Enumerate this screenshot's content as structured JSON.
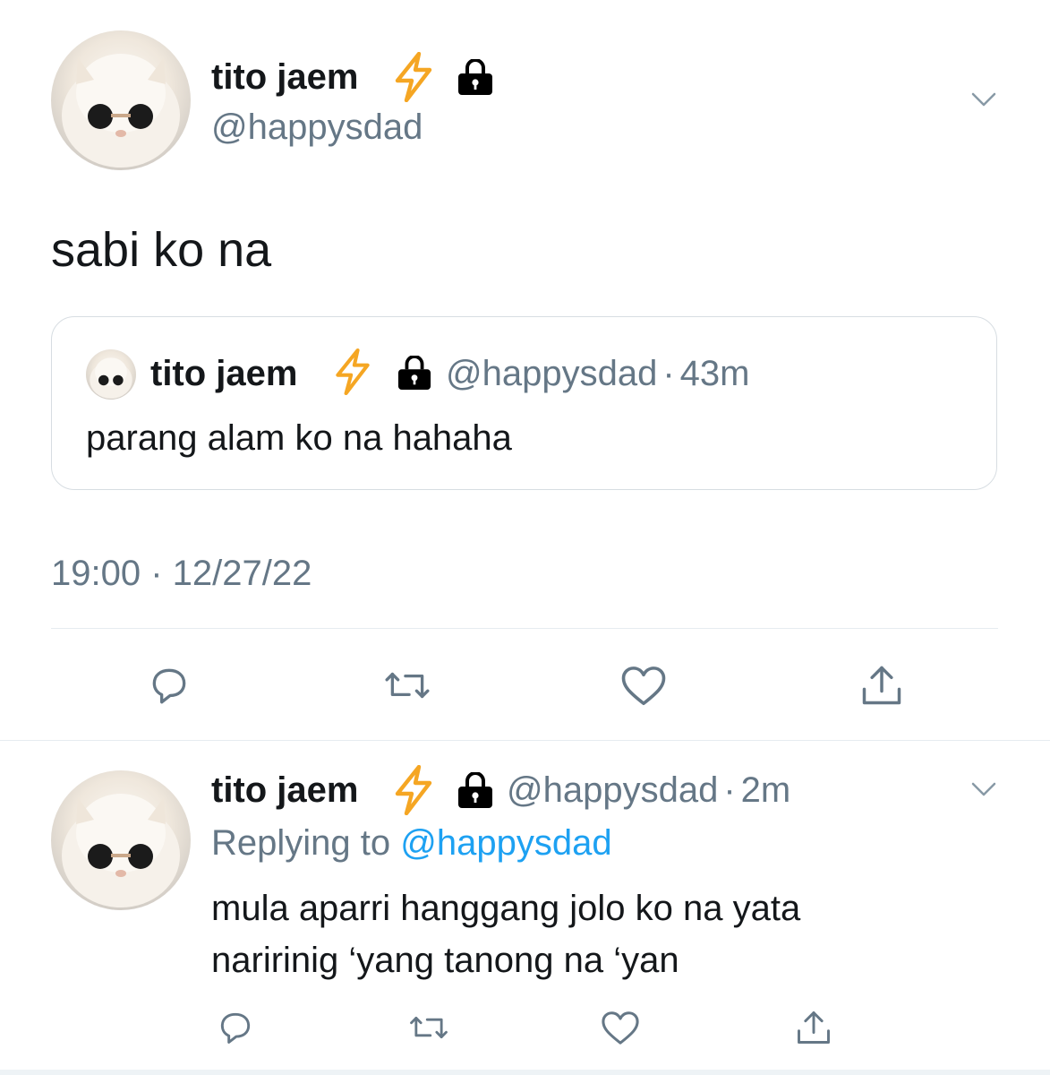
{
  "main_tweet": {
    "author_name": "tito jaem",
    "author_handle": "@happysdad",
    "text": "sabi ko na",
    "timestamp": "19:00 · 12/27/22",
    "quoted": {
      "author_name": "tito jaem",
      "author_handle": "@happysdad",
      "separator": "·",
      "time": "43m",
      "text": "parang alam ko na hahaha"
    }
  },
  "reply_tweet": {
    "author_name": "tito jaem",
    "author_handle": "@happysdad",
    "separator": "·",
    "time": "2m",
    "replying_prefix": "Replying to",
    "replying_handle": "@happysdad",
    "text_line1": "mula aparri hanggang jolo ko na yata",
    "text_line2": "naririnig ‘yang tanong na ‘yan"
  },
  "icons": {
    "badge_emoji": "⚡",
    "actions": [
      "reply-icon",
      "retweet-icon",
      "like-icon",
      "share-icon"
    ],
    "menu": "chevron-down-icon",
    "lock": "lock-icon"
  },
  "colors": {
    "link": "#1da1f2",
    "muted": "#657786",
    "text": "#14171a",
    "bolt": "#f5a623"
  }
}
